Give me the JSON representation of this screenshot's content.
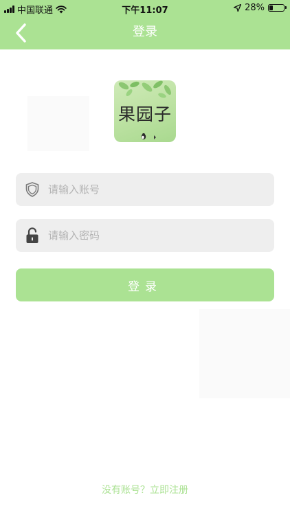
{
  "status_bar": {
    "carrier": "中国联通",
    "time": "下午11:07",
    "battery": "28%",
    "battery_level": 0.28
  },
  "header": {
    "title": "登录",
    "back_icon": "chevron-left-icon"
  },
  "logo": {
    "text": "果园子"
  },
  "form": {
    "account_placeholder": "请输入账号",
    "account_value": "",
    "account_icon": "shield-icon",
    "password_placeholder": "请输入密码",
    "password_value": "",
    "password_icon": "unlock-icon",
    "login_label": "登录"
  },
  "footer": {
    "register_text": "没有账号？立即注册"
  },
  "colors": {
    "accent": "#abe293",
    "field_bg": "#eeeeee",
    "placeholder": "#b3b3b3"
  }
}
